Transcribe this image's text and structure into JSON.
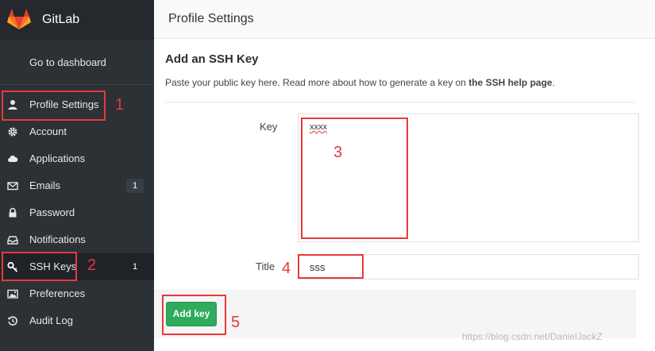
{
  "app": {
    "brand_name": "GitLab",
    "dashboard_link": "Go to dashboard",
    "colors": {
      "sidebar": "#2c3136",
      "brand_bar": "#25292d",
      "accent_green": "#2eab5b",
      "annotation_red": "#e8393a"
    }
  },
  "sidebar": {
    "items": [
      {
        "label": "Profile Settings",
        "icon": "user-icon"
      },
      {
        "label": "Account",
        "icon": "gear-icon"
      },
      {
        "label": "Applications",
        "icon": "cloud-icon"
      },
      {
        "label": "Emails",
        "icon": "envelope-icon",
        "badge": "1"
      },
      {
        "label": "Password",
        "icon": "lock-icon"
      },
      {
        "label": "Notifications",
        "icon": "inbox-icon"
      },
      {
        "label": "SSH Keys",
        "icon": "key-icon",
        "badge": "1",
        "active": true
      },
      {
        "label": "Preferences",
        "icon": "image-icon"
      },
      {
        "label": "Audit Log",
        "icon": "history-icon"
      }
    ]
  },
  "header": {
    "title": "Profile Settings"
  },
  "main": {
    "section_title": "Add an SSH Key",
    "help_text_prefix": "Paste your public key here. Read more about how to generate a key on ",
    "help_text_link": "the SSH help page",
    "help_text_suffix": ".",
    "key_label": "Key",
    "key_value": "xxxx",
    "title_label": "Title",
    "title_value": "sss",
    "submit_label": "Add key"
  },
  "annotations": [
    "1",
    "2",
    "3",
    "4",
    "5"
  ],
  "watermark": "https://blog.csdn.net/DanielJackZ"
}
